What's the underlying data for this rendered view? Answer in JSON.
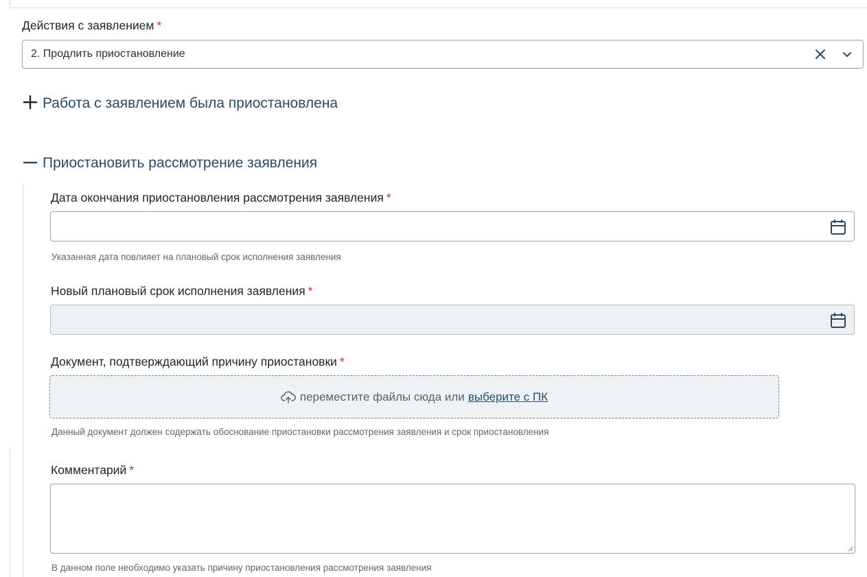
{
  "action_field": {
    "label": "Действия с заявлением",
    "required_mark": "*",
    "value": "2. Продлить приостановление",
    "clear_icon": "close-icon",
    "toggle_icon": "chevron-down-icon"
  },
  "sections": [
    {
      "title": "Работа с заявлением была приостановлена",
      "expanded": false,
      "icon": "plus-icon"
    },
    {
      "title": "Приостановить рассмотрение заявления",
      "expanded": true,
      "icon": "minus-icon"
    }
  ],
  "suspend_form": {
    "end_date": {
      "label": "Дата окончания приостановления рассмотрения заявления",
      "required_mark": "*",
      "value": "",
      "hint": "Указанная дата повлияет на плановый срок исполнения заявления",
      "icon": "calendar-icon"
    },
    "new_deadline": {
      "label": "Новый плановый срок исполнения заявления",
      "required_mark": "*",
      "value": "",
      "disabled": true,
      "icon": "calendar-icon"
    },
    "document": {
      "label": "Документ, подтверждающий причину приостановки",
      "required_mark": "*",
      "drop_text": "переместите файлы сюда или",
      "pick_link": "выберите с ПК",
      "hint": "Данный документ должен содержать обоснование приостановки рассмотрения заявления и срок приостановления",
      "icon": "cloud-upload-icon"
    },
    "comment": {
      "label": "Комментарий",
      "required_mark": "*",
      "value": "",
      "hint": "В данном поле необходимо указать причину приостановления рассмотрения заявления"
    }
  },
  "colors": {
    "accent": "#2a4a6b",
    "required": "#d0342c",
    "link": "#1d4f7c",
    "border": "#9aa1a8",
    "disabled_bg": "#eef1f3"
  }
}
